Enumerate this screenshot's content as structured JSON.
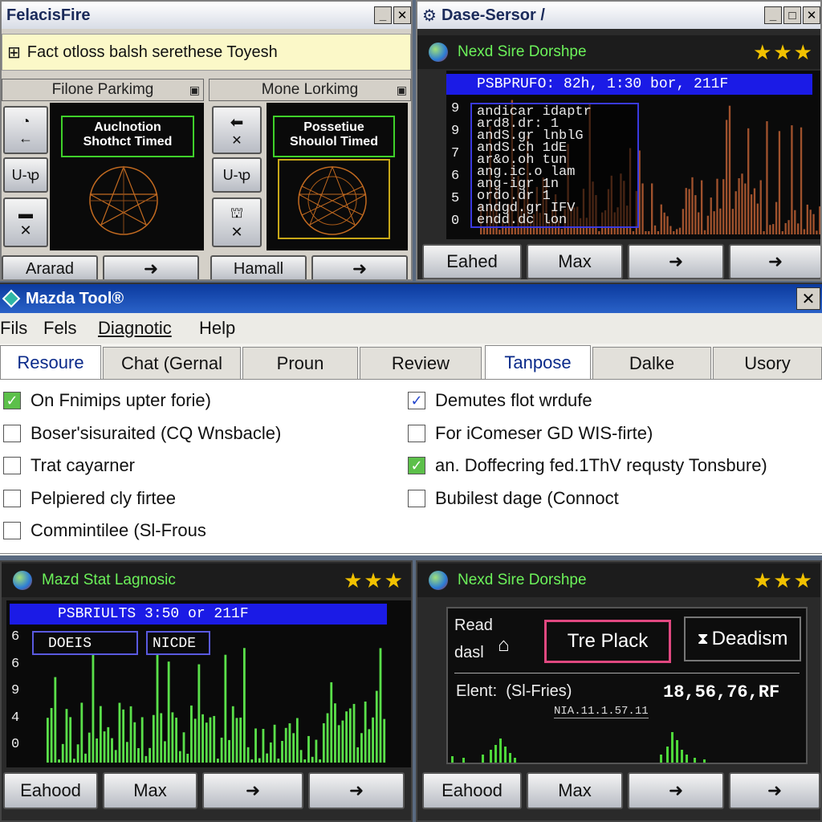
{
  "win1": {
    "title": "FelacisFire",
    "info": "Fact otloss balsh serethese Toyesh",
    "left": {
      "title": "Filone Parkimg",
      "box": "Auclnotion\nShothct Timed",
      "bottom": "Ararad"
    },
    "right": {
      "title": "Mone Lorkimg",
      "box": "Possetiue\nShoulol Timed",
      "bottom": "Hamall"
    },
    "btn_ul": "U-ꝕ"
  },
  "win2": {
    "title": "Dase-Sersor /",
    "sub": "Nexd Sire Dorshpe",
    "stars": "★★★",
    "banner": "PSBPRUFO: 82h, 1:30 bor, 211F",
    "lines": [
      "andicar idaptr",
      "ard8.dr: 1",
      "andS.gr lnblG",
      "andS.ch  1dE",
      "ar&o.oh tun",
      "ang.ic.o  lam",
      "ang-igr  1n",
      "ordo.dr  1",
      "andgd.gr IFV",
      "endd.dc lon"
    ],
    "yticks": [
      "9",
      "9",
      "7",
      "6",
      "5",
      "0"
    ],
    "buttons": [
      "Eahed",
      "Max",
      "➜",
      "➜"
    ]
  },
  "main": {
    "title": "Mazda Tool®",
    "menu": [
      "Fils",
      "Fels",
      "Diagnotic",
      "Help"
    ],
    "tabs": [
      "Resoure",
      "Chat (Gernal",
      "Proun",
      "Review",
      "Tanpose",
      "Dalke",
      "Usory"
    ],
    "left_checks": [
      {
        "label": "On Fnimips upter forie)",
        "state": "green"
      },
      {
        "label": "Boser'sisuraited (CQ Wnsbacle)",
        "state": "off"
      },
      {
        "label": "Trat cayarner",
        "state": "off"
      },
      {
        "label": "Pelpiered cly firtee",
        "state": "off"
      },
      {
        "label": "Commintilee (Sl-Frous",
        "state": "off"
      }
    ],
    "right_checks": [
      {
        "label": "Demutes flot wrdufe",
        "state": "on"
      },
      {
        "label": "For iComeser GD WIS-firte)",
        "state": "off"
      },
      {
        "label": "an. Doffecring fed.1ThV requsty Tonsbure)",
        "state": "green"
      },
      {
        "label": "Bubilest dage (Connoct",
        "state": "off"
      }
    ]
  },
  "bl": {
    "title": "Mazd Stat Lagnosic",
    "stars": "★★★",
    "banner": "PSBRIULTS 3:50 or 211F",
    "box1": "DOEIS",
    "box2": "NICDE",
    "yticks": [
      "6",
      "6",
      "9",
      "4",
      "0"
    ],
    "buttons": [
      "Eahood",
      "Max",
      "➜",
      "➜"
    ]
  },
  "br": {
    "title": "Nexd Sire Dorshpe",
    "stars": "★★★",
    "read": "Read",
    "dasl": "dasl",
    "button1": "Tre Plack",
    "button2": "Deadism",
    "elent": "Elent:  (Sl-Fries)",
    "value": "18,56,76,RF",
    "small": "NIA.11.1.57.11",
    "buttons": [
      "Eahood",
      "Max",
      "➜",
      "➜"
    ]
  },
  "colors": {
    "accent": "#1b1be6",
    "bars": "#5ae04a",
    "title_blue": "#0b3a9e"
  }
}
